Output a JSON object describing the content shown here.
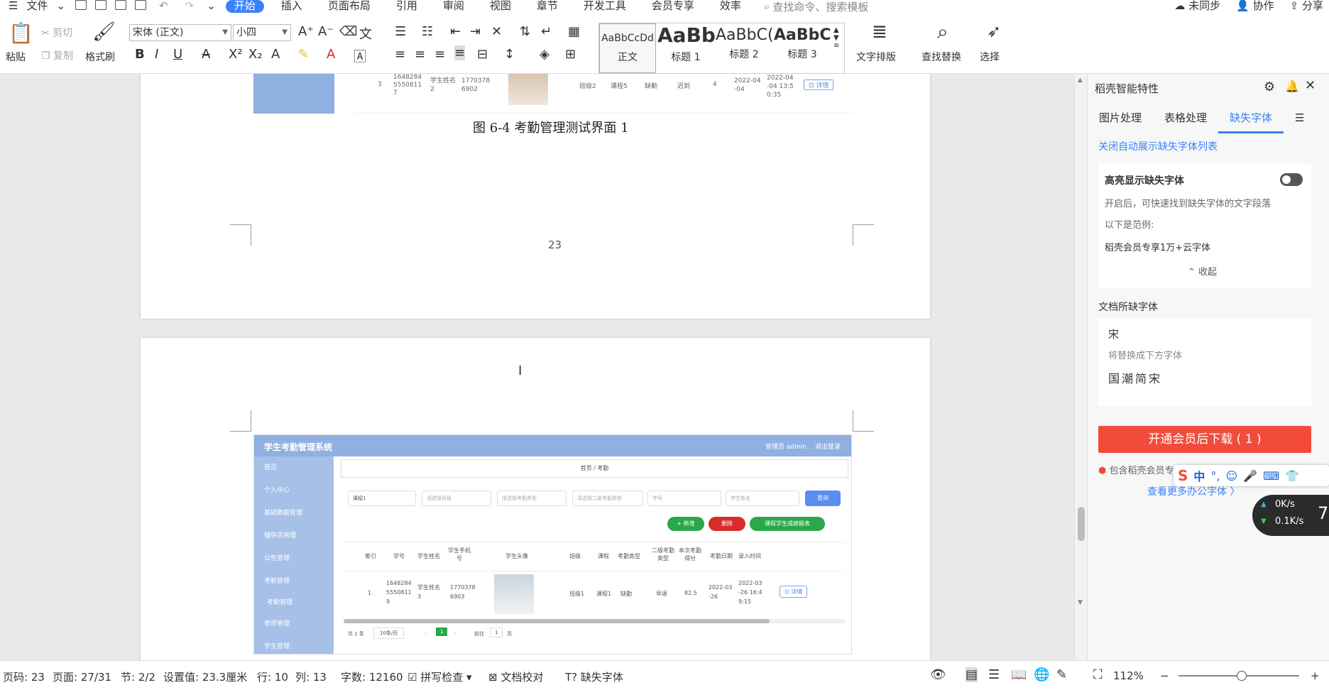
{
  "menubar": {
    "file": "文件",
    "tabs": [
      "开始",
      "插入",
      "页面布局",
      "引用",
      "审阅",
      "视图",
      "章节",
      "开发工具",
      "会员专享",
      "效率"
    ],
    "active_tab": "开始",
    "search_placeholder": "查找命令、搜索模板",
    "sync": "未同步",
    "collab": "协作",
    "share": "分享"
  },
  "ribbon": {
    "paste": "粘贴",
    "cut": "剪切",
    "copy": "复制",
    "format_painter": "格式刷",
    "font_name": "宋体 (正文)",
    "font_size": "小四",
    "styles": [
      {
        "sample": "AaBbCcDd",
        "label": "正文"
      },
      {
        "sample": "AaBb",
        "label": "标题 1"
      },
      {
        "sample": "AaBbC(",
        "label": "标题 2"
      },
      {
        "sample": "AaBbC(",
        "label": "标题 3"
      }
    ],
    "text_layout": "文字排版",
    "find_replace": "查找替换",
    "select": "选择"
  },
  "document": {
    "caption": "图 6-4 考勤管理测试界面 1",
    "page_number": "23",
    "prev_row": [
      "3",
      "1648284\n5550811\n7",
      "学生姓名\n2",
      "1770378\n6902",
      "班级2",
      "课程5",
      "缺勤",
      "迟到",
      "4",
      "2022-04\n-04",
      "2022-04\n-04 13:5\n0:35"
    ],
    "prev_detail_btn": "详情"
  },
  "embedded": {
    "title": "学生考勤管理系统",
    "user": "管理员 admin",
    "logout": "退出登录",
    "breadcrumb": "首页 / 考勤",
    "side": [
      "首页",
      "个人中心",
      "基础数据管理",
      "辅导员管理",
      "公告管理",
      "考勤管理",
      "考勤管理",
      "老师管理",
      "学生管理"
    ],
    "filters": [
      "课程1",
      "请选择班级",
      "请选择考勤类型",
      "请选择二级考勤类型",
      "学号",
      "学生姓名"
    ],
    "query_btn": "查询",
    "add_btn": "+ 新增",
    "del_btn": "删除",
    "report_btn": "课程学生成绩报表",
    "cols": [
      "索引",
      "学号",
      "学生姓名",
      "学生手机号",
      "学生头像",
      "班级",
      "课程",
      "考勤类型",
      "二级考勤类型",
      "本次考勤得分",
      "考勤日期",
      "录入时间"
    ],
    "row": [
      "1",
      "1648284\n5550811\n9",
      "学生姓名\n3",
      "1770378\n6903",
      "",
      "班级1",
      "课程1",
      "缺勤",
      "早退",
      "82.5",
      "2022-03\n-26",
      "2022-03\n-26 16:4\n9:15"
    ],
    "detail_btn": "详情",
    "pager_total": "共 1 条",
    "pager_size": "10条/页",
    "pager_current": "1",
    "pager_goto": "前往",
    "pager_goto_val": "1",
    "pager_page": "页"
  },
  "panel": {
    "title": "稻壳智能特性",
    "tabs": [
      "图片处理",
      "表格处理",
      "缺失字体"
    ],
    "active_tab": "缺失字体",
    "close_auto": "关闭自动展示缺失字体列表",
    "highlight_title": "高亮显示缺失字体",
    "highlight_desc": "开启后，可快速找到缺失字体的文字段落",
    "example_label": "以下是范例:",
    "example_text": "稻壳会员专享1万+云字体",
    "collapse": "收起",
    "missing_title": "文档所缺字体",
    "missing_font": "宋",
    "replace_label": "将替换成下方字体",
    "replace_font": "国潮简宋",
    "download_btn": "开通会员后下载 ( 1 )",
    "member_note": "包含稻壳会员专享字体，需开通稻壳会员",
    "more_fonts": "查看更多办公字体 〉"
  },
  "status": {
    "page_code": "页码: 23",
    "page": "页面: 27/31",
    "section": "节: 2/2",
    "setting": "设置值: 23.3厘米",
    "row": "行: 10",
    "col": "列: 13",
    "words": "字数: 12160",
    "spell": "拼写检查",
    "proof": "文档校对",
    "missing_font": "缺失字体",
    "zoom": "112%"
  },
  "overlay": {
    "ime_lang": "中",
    "speed_up": "0K/s",
    "speed_down": "0.1K/s",
    "speed_badge": "7"
  }
}
